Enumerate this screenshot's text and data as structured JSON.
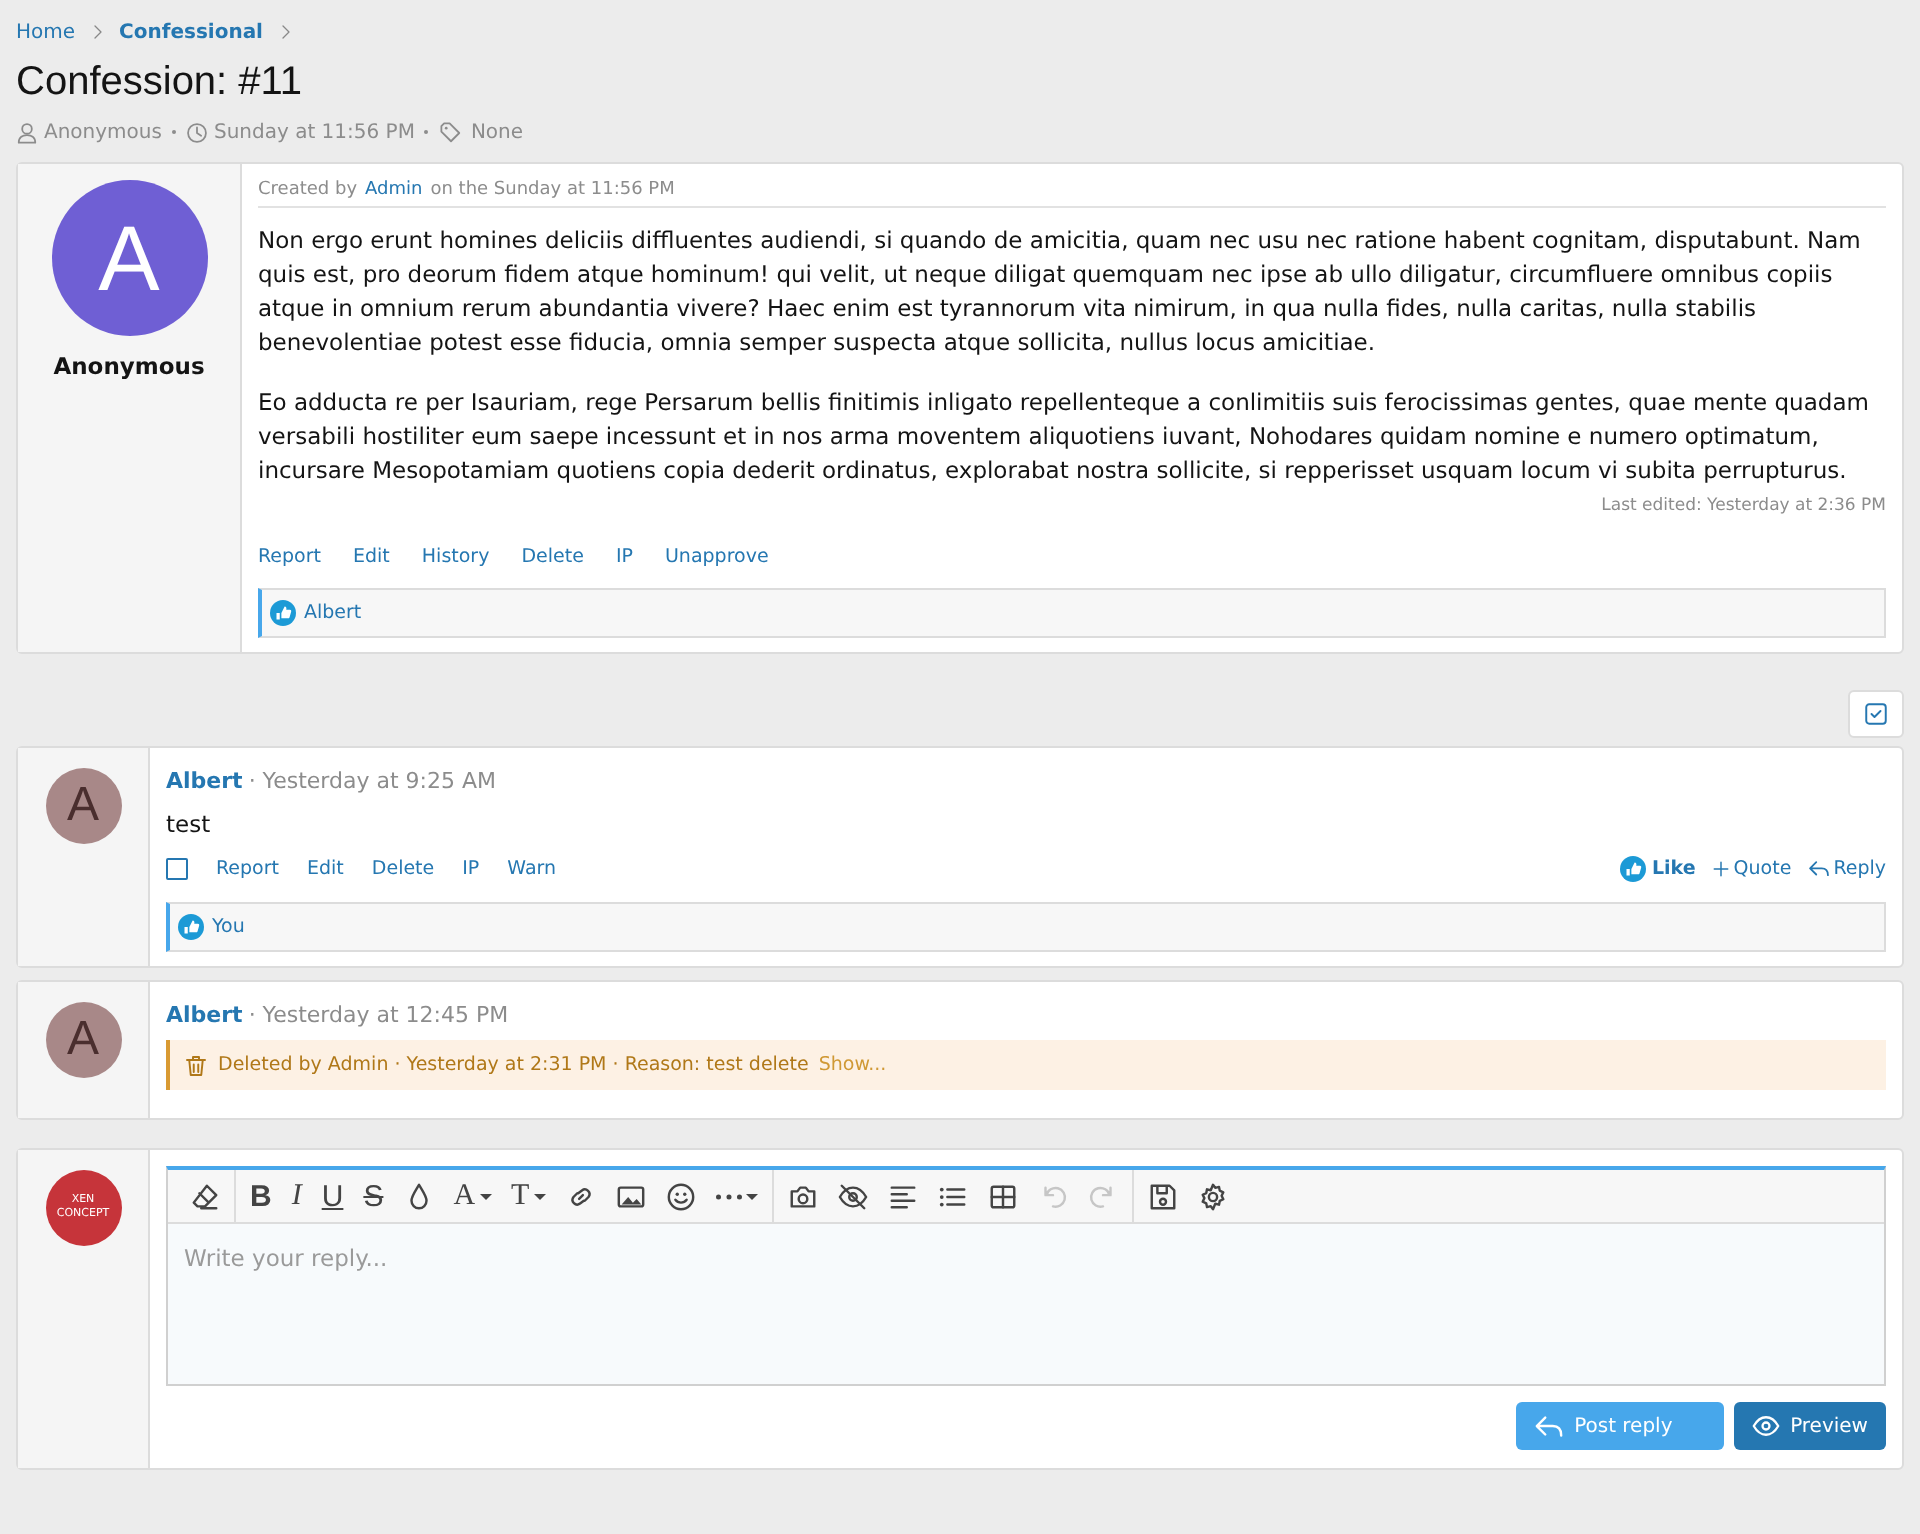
{
  "breadcrumb": [
    {
      "label": "Home",
      "current": false
    },
    {
      "label": "Confessional",
      "current": true
    }
  ],
  "title": "Confession: #11",
  "meta": {
    "author": "Anonymous",
    "time": "Sunday at 11:56 PM",
    "tags": "None"
  },
  "post": {
    "avatar_letter": "A",
    "username": "Anonymous",
    "created_prefix": "Created by",
    "created_by": "Admin",
    "created_suffix": "on the Sunday at 11:56 PM",
    "paragraphs": [
      "Non ergo erunt homines deliciis diffluentes audiendi, si quando de amicitia, quam nec usu nec ratione habent cognitam, disputabunt. Nam quis est, pro deorum fidem atque hominum! qui velit, ut neque diligat quemquam nec ipse ab ullo diligatur, circumfluere omnibus copiis atque in omnium rerum abundantia vivere? Haec enim est tyrannorum vita nimirum, in qua nulla fides, nulla caritas, nulla stabilis benevolentiae potest esse fiducia, omnia semper suspecta atque sollicita, nullus locus amicitiae.",
      "Eo adducta re per Isauriam, rege Persarum bellis finitimis inligato repellenteque a conlimitiis suis ferocissimas gentes, quae mente quadam versabili hostiliter eum saepe incessunt et in nos arma moventem aliquotiens iuvant, Nohodares quidam nomine e numero optimatum, incursare Mesopotamiam quotiens copia dederit ordinatus, explorabat nostra sollicite, si repperisset usquam locum vi subita perrupturus."
    ],
    "last_edited": "Last edited: Yesterday at 2:36 PM",
    "actions": [
      "Report",
      "Edit",
      "History",
      "Delete",
      "IP",
      "Unapprove"
    ],
    "reaction": "Albert"
  },
  "comments": [
    {
      "kind": "normal",
      "avatar_letter": "A",
      "author": "Albert",
      "time": "· Yesterday at 9:25 AM",
      "body": "test",
      "checked": false,
      "actions": [
        "Report",
        "Edit",
        "Delete",
        "IP",
        "Warn"
      ],
      "like": "Like",
      "liked": true,
      "quote": "Quote",
      "reply": "Reply",
      "reaction": "You"
    },
    {
      "kind": "deleted",
      "avatar_letter": "A",
      "author": "Albert",
      "time": "· Yesterday at 12:45 PM",
      "notice": "Deleted by Admin · Yesterday at 2:31 PM · Reason: test delete",
      "show": "Show..."
    }
  ],
  "editor": {
    "avatar_lines": [
      "XEN",
      "CONCEPT"
    ],
    "letters": [
      "B",
      "I",
      "U",
      "S",
      "A",
      "T"
    ],
    "placeholder": "Write your reply...",
    "buttons": [
      "Post reply",
      "Preview"
    ]
  }
}
